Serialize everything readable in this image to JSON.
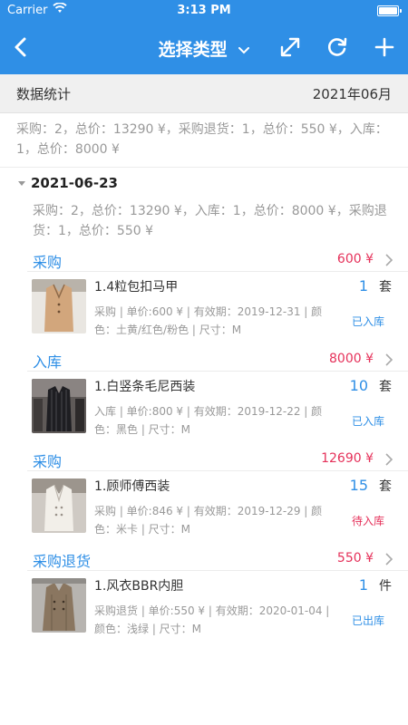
{
  "status_bar": {
    "carrier": "Carrier",
    "time": "3:13 PM"
  },
  "nav": {
    "title": "选择类型",
    "back_icon": "chevron-left-icon",
    "expand_icon": "expand-icon",
    "refresh_icon": "refresh-icon",
    "add_icon": "plus-icon"
  },
  "stats": {
    "label": "数据统计",
    "month": "2021年06月"
  },
  "summary": "采购：2，总价：13290 ¥，采购退货：1，总价：550 ¥，入库：1，总价：8000 ¥",
  "date_group": {
    "date": "2021-06-23",
    "summary": "采购：2，总价：13290 ¥，入库：1，总价：8000 ¥，采购退货：1，总价：550 ¥"
  },
  "sections": [
    {
      "name": "采购",
      "amount": "600 ¥",
      "item": {
        "name": "1.4粒包扣马甲",
        "qty": "1",
        "unit": "套",
        "detail": "采购 | 单价:600 ¥ | 有效期：2019-12-31 | 颜色：土黄/红色/粉色 | 尺寸：M",
        "status": "已入库",
        "status_color": "#2f8fe6"
      }
    },
    {
      "name": "入库",
      "amount": "8000 ¥",
      "item": {
        "name": "1.白竖条毛尼西装",
        "qty": "10",
        "unit": "套",
        "detail": "入库 | 单价:800 ¥ | 有效期：2019-12-22 | 颜色：黑色 | 尺寸：M",
        "status": "已入库",
        "status_color": "#2f8fe6"
      }
    },
    {
      "name": "采购",
      "amount": "12690 ¥",
      "item": {
        "name": "1.顾师傅西装",
        "qty": "15",
        "unit": "套",
        "detail": "采购 | 单价:846 ¥ | 有效期：2019-12-29 | 颜色：米卡 | 尺寸：M",
        "status": "待入库",
        "status_color": "#e5315a"
      }
    },
    {
      "name": "采购退货",
      "amount": "550 ¥",
      "item": {
        "name": "1.风衣BBR内胆",
        "qty": "1",
        "unit": "件",
        "detail": "采购退货 | 单价:550 ¥ | 有效期：2020-01-04 | 颜色：浅绿 | 尺寸：M",
        "status": "已出库",
        "status_color": "#2f8fe6"
      }
    }
  ],
  "colors": {
    "primary": "#2f8fe6",
    "accent_red": "#e5315a"
  }
}
